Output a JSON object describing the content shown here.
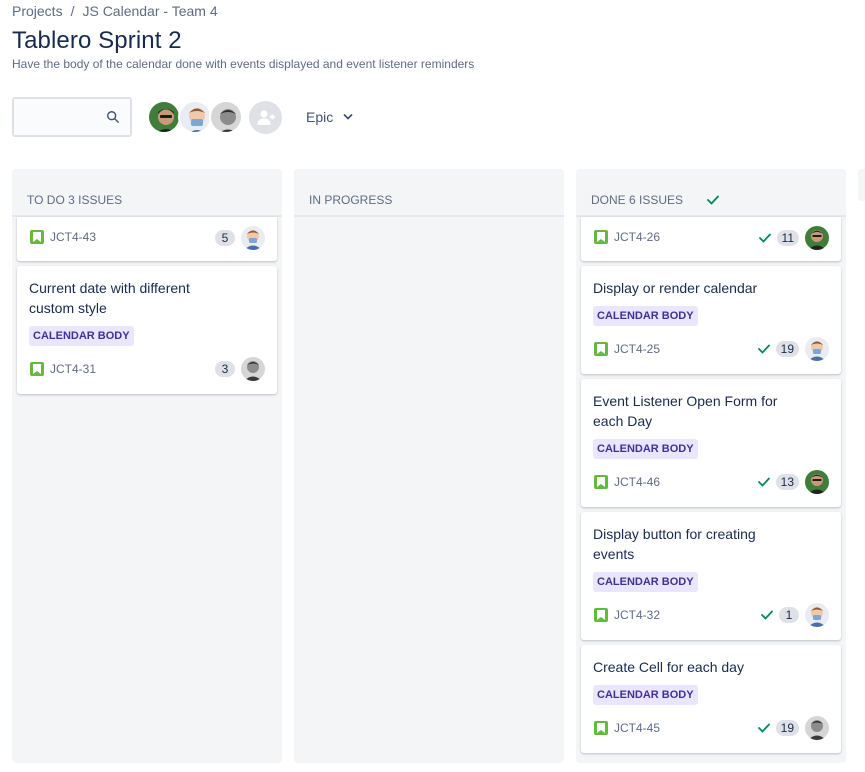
{
  "breadcrumb": {
    "projects": "Projects",
    "separator": "/",
    "project": "JS Calendar - Team 4"
  },
  "page": {
    "title": "Tablero Sprint 2",
    "subtitle": "Have the body of the calendar done with events displayed and event listener reminders"
  },
  "toolbar": {
    "search_value": "",
    "epic_label": "Epic"
  },
  "columns": [
    {
      "title": "TO DO 3 ISSUES"
    },
    {
      "title": "IN PROGRESS"
    },
    {
      "title": "DONE 6 ISSUES"
    }
  ],
  "todo_cards": [
    {
      "key": "JCT4-43",
      "points": "5"
    },
    {
      "title": "Current date with different custom style",
      "label": "CALENDAR BODY",
      "key": "JCT4-31",
      "points": "3"
    }
  ],
  "done_cards": [
    {
      "key": "JCT4-26",
      "points": "11"
    },
    {
      "title": "Display or render calendar",
      "label": "CALENDAR BODY",
      "key": "JCT4-25",
      "points": "19"
    },
    {
      "title": "Event Listener Open Form for each Day",
      "label": "CALENDAR BODY",
      "key": "JCT4-46",
      "points": "13"
    },
    {
      "title": "Display button for creating events",
      "label": "CALENDAR BODY",
      "key": "JCT4-32",
      "points": "1"
    },
    {
      "title": "Create Cell for each day",
      "label": "CALENDAR BODY",
      "key": "JCT4-45",
      "points": "19"
    }
  ],
  "colors": {
    "story_green": "#63ba3c",
    "label_bg": "#eae6ff",
    "label_text": "#403294",
    "done_check": "#00875a",
    "column_bg": "#f4f5f7"
  }
}
